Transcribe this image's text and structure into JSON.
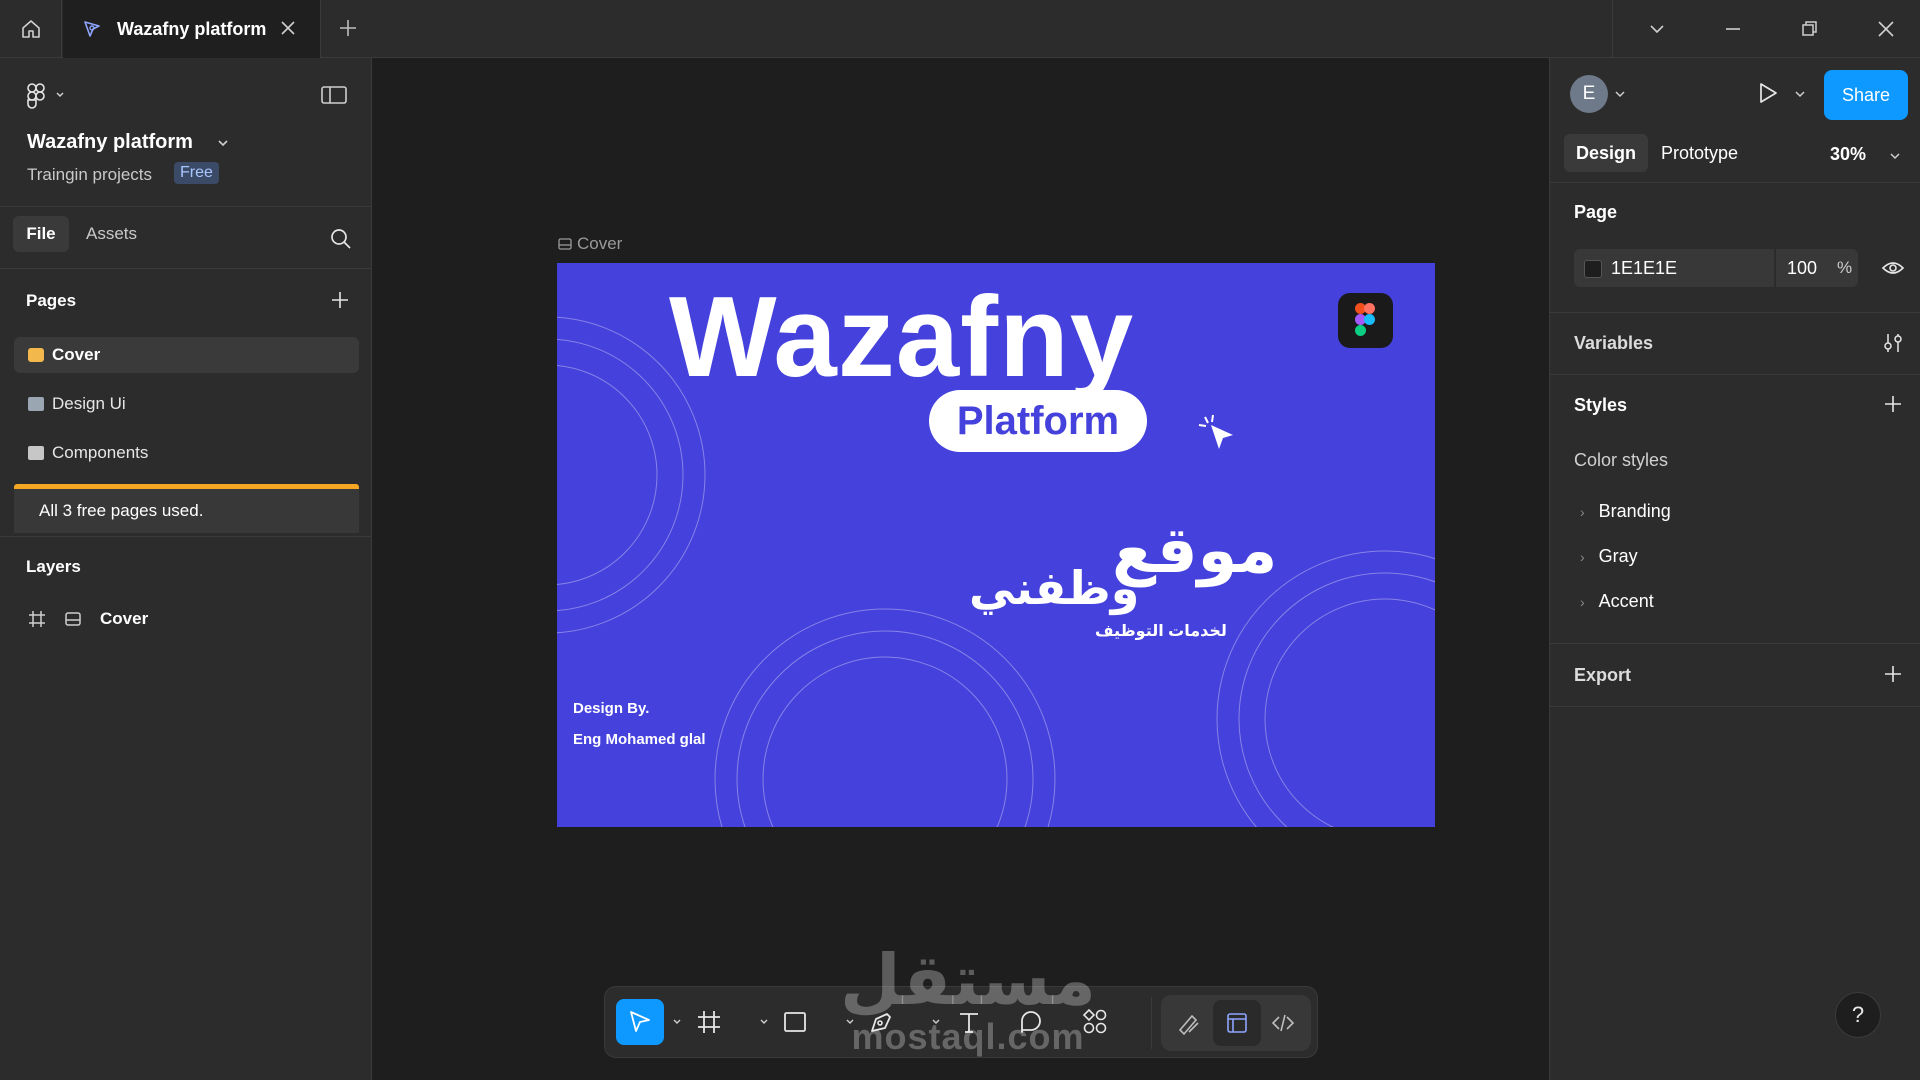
{
  "titlebar": {
    "tab_title": "Wazafny platform"
  },
  "left_panel": {
    "project_name": "Wazafny platform",
    "team_name": "Traingin projects",
    "plan_badge": "Free",
    "tabs": {
      "file": "File",
      "assets": "Assets"
    },
    "pages_title": "Pages",
    "pages": [
      {
        "label": "Cover",
        "selected": true,
        "emoji_color": "#f2b84b"
      },
      {
        "label": "Design Ui",
        "selected": false,
        "emoji_color": "#9aa6b2"
      },
      {
        "label": "Components",
        "selected": false,
        "emoji_color": "#c7c7c7"
      }
    ],
    "page_limit_notice": "All 3 free pages used.",
    "layers_title": "Layers",
    "layers": [
      {
        "label": "Cover"
      }
    ]
  },
  "canvas": {
    "frame_label": "Cover",
    "frame_background": "#4541dc",
    "cover": {
      "brand": "Wazafny",
      "pill": "Platform",
      "arabic_title": "موقع",
      "arabic_sub": "وظفني",
      "arabic_tagline": "لخدمات التوظيف",
      "credit_line1": "Design By.",
      "credit_line2": "Eng Mohamed glal"
    }
  },
  "toolbar": {
    "tools": [
      "move-tool",
      "frame-tool",
      "shape-tool",
      "pen-tool",
      "text-tool",
      "comment-tool",
      "actions-tool"
    ],
    "modes": [
      "draw-mode",
      "design-mode",
      "dev-mode"
    ],
    "accent": "#0d99ff"
  },
  "watermark": {
    "arabic": "مستقل",
    "latin": "mostaql.com"
  },
  "right_panel": {
    "avatar_letter": "E",
    "share_label": "Share",
    "tabs": {
      "design": "Design",
      "prototype": "Prototype"
    },
    "zoom": "30%",
    "page_section": "Page",
    "page_color_hex": "1E1E1E",
    "page_opacity": "100",
    "percent_sign": "%",
    "variables": "Variables",
    "styles": "Styles",
    "color_styles": "Color styles",
    "style_groups": [
      "Branding",
      "Gray",
      "Accent"
    ],
    "export": "Export",
    "help": "?"
  }
}
